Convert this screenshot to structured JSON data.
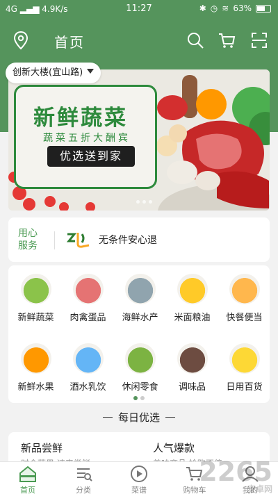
{
  "status": {
    "network": "4G",
    "speed": "4.9K/s",
    "time": "11:27",
    "battery": "63%",
    "battery_level": 0.63
  },
  "nav": {
    "title": "首页",
    "icons": [
      "location-pin-icon",
      "search-icon",
      "cart-icon",
      "scan-icon"
    ]
  },
  "address": {
    "label": "创新大楼(宜山路)"
  },
  "banner": {
    "headline": "新鲜蔬菜",
    "subline": "蔬菜五折大酬宾",
    "pill": "优选送到家",
    "slides": 3
  },
  "service": {
    "label": "用心服务",
    "text": "无条件安心退"
  },
  "categories": [
    {
      "name": "新鲜蔬菜",
      "color": "#8bc34a"
    },
    {
      "name": "肉禽蛋品",
      "color": "#e57373"
    },
    {
      "name": "海鲜水产",
      "color": "#90a4ae"
    },
    {
      "name": "米面粮油",
      "color": "#ffca28"
    },
    {
      "name": "快餐便当",
      "color": "#ffb74d"
    },
    {
      "name": "新鲜水果",
      "color": "#ff9800"
    },
    {
      "name": "酒水乳饮",
      "color": "#64b5f6"
    },
    {
      "name": "休闲零食",
      "color": "#7cb342"
    },
    {
      "name": "调味品",
      "color": "#6d4c41"
    },
    {
      "name": "日用百货",
      "color": "#fdd835"
    }
  ],
  "daily": {
    "title": "每日优选"
  },
  "picks": [
    {
      "title": "新品尝鲜",
      "sub": "时令蔬果 速来尝鲜"
    },
    {
      "title": "人气爆款",
      "sub": "美味商品 抢购不停"
    }
  ],
  "tabs": [
    {
      "label": "首页",
      "icon": "home-icon",
      "active": true
    },
    {
      "label": "分类",
      "icon": "category-icon",
      "active": false
    },
    {
      "label": "菜谱",
      "icon": "play-icon",
      "active": false
    },
    {
      "label": "购物车",
      "icon": "cart-icon",
      "active": false
    },
    {
      "label": "我的",
      "icon": "user-icon",
      "active": false
    }
  ],
  "watermark": {
    "text": "2265",
    "sub": "安卓网"
  }
}
